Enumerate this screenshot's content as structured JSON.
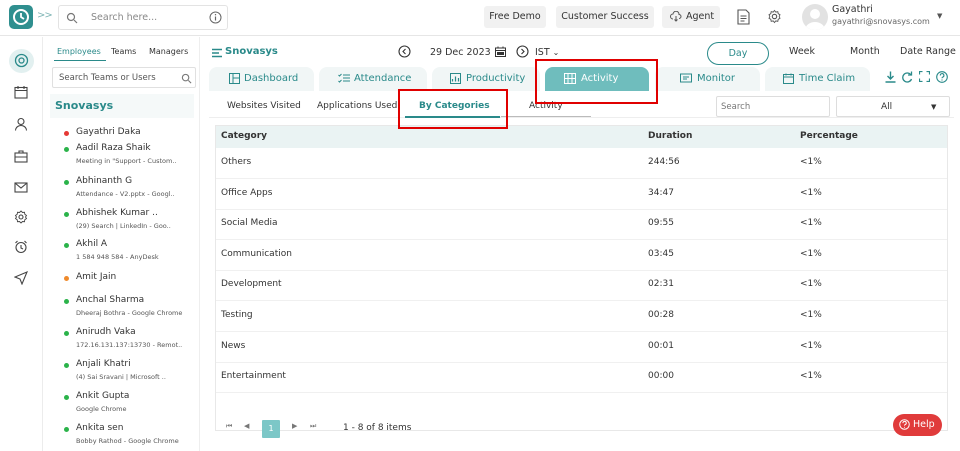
{
  "topbar": {
    "search_placeholder": "Search here...",
    "buttons": {
      "free_demo": "Free Demo",
      "customer_success": "Customer Success",
      "agent": "Agent"
    },
    "user": {
      "name": "Gayathri",
      "email": "gayathri@snovasys.com"
    }
  },
  "employees": {
    "tabs": {
      "employees": "Employees",
      "teams": "Teams",
      "managers": "Managers"
    },
    "search_placeholder": "Search Teams or Users",
    "org": "Snovasys",
    "list": [
      {
        "name": "Gayathri Daka",
        "sub": "",
        "status": "#e53935"
      },
      {
        "name": "Aadil Raza Shaik",
        "sub": "Meeting in \"Support - Custom..",
        "status": "#2bb34a"
      },
      {
        "name": "Abhinanth G",
        "sub": "Attendance - V2.pptx - Googl..",
        "status": "#2bb34a"
      },
      {
        "name": "Abhishek Kumar ..",
        "sub": "(29) Search | LinkedIn - Goo..",
        "status": "#2bb34a"
      },
      {
        "name": "Akhil A",
        "sub": "1 584 948 584 - AnyDesk",
        "status": "#2bb34a"
      },
      {
        "name": "Amit Jain",
        "sub": "",
        "status": "#ef8a2c"
      },
      {
        "name": "Anchal Sharma",
        "sub": "Dheeraj Bothra - Google Chrome",
        "status": "#2bb34a"
      },
      {
        "name": "Anirudh Vaka",
        "sub": "172.16.131.137:13730 - Remot..",
        "status": "#2bb34a"
      },
      {
        "name": "Anjali Khatri",
        "sub": "(4) Sai Sravani | Microsoft ..",
        "status": "#2bb34a"
      },
      {
        "name": "Ankit Gupta",
        "sub": "Google Chrome",
        "status": "#2bb34a"
      },
      {
        "name": "Ankita sen",
        "sub": "Bobby Rathod - Google Chrome",
        "status": "#2bb34a"
      }
    ]
  },
  "header": {
    "brand": "Snovasys",
    "date": "29 Dec 2023",
    "timezone": "IST",
    "range": {
      "day": "Day",
      "week": "Week",
      "month": "Month",
      "date_range": "Date Range"
    }
  },
  "tabs": {
    "dashboard": "Dashboard",
    "attendance": "Attendance",
    "productivity": "Productivity",
    "activity": "Activity",
    "monitor": "Monitor",
    "time_claim": "Time Claim"
  },
  "subtabs": {
    "websites": "Websites Visited",
    "apps": "Applications Used",
    "by_categories": "By Categories",
    "activity": "Activity"
  },
  "filters": {
    "search_placeholder": "Search",
    "select_value": "All"
  },
  "table": {
    "headers": {
      "category": "Category",
      "duration": "Duration",
      "percentage": "Percentage"
    },
    "rows": [
      {
        "category": "Others",
        "duration": "244:56",
        "percentage": "<1%"
      },
      {
        "category": "Office Apps",
        "duration": "34:47",
        "percentage": "<1%"
      },
      {
        "category": "Social Media",
        "duration": "09:55",
        "percentage": "<1%"
      },
      {
        "category": "Communication",
        "duration": "03:45",
        "percentage": "<1%"
      },
      {
        "category": "Development",
        "duration": "02:31",
        "percentage": "<1%"
      },
      {
        "category": "Testing",
        "duration": "00:28",
        "percentage": "<1%"
      },
      {
        "category": "News",
        "duration": "00:01",
        "percentage": "<1%"
      },
      {
        "category": "Entertainment",
        "duration": "00:00",
        "percentage": "<1%"
      }
    ]
  },
  "pagination": {
    "current_page": "1",
    "info": "1 - 8 of 8 items"
  },
  "help": {
    "label": "Help"
  }
}
